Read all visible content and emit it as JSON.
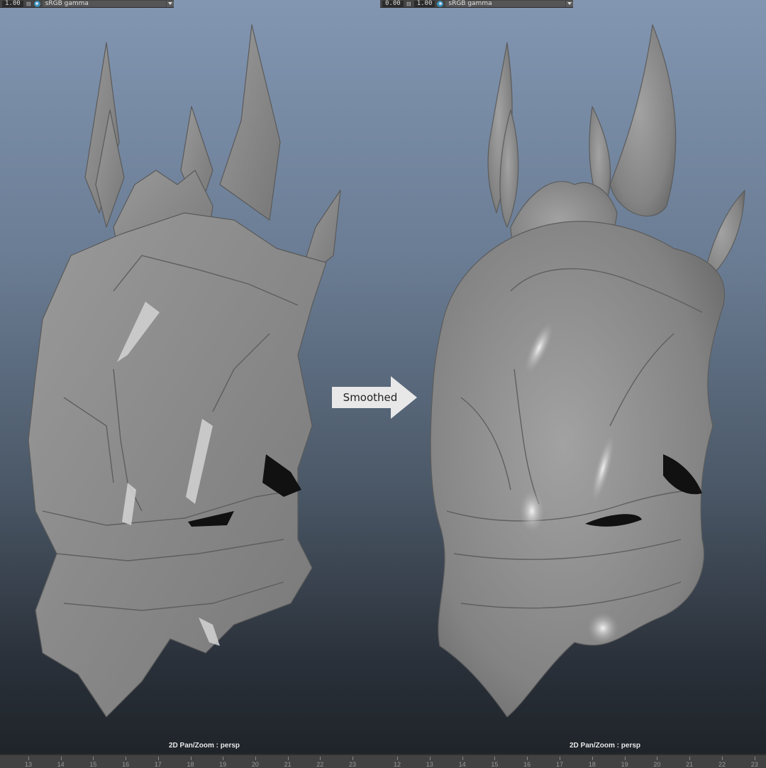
{
  "left_panel": {
    "field_value": "1.00",
    "color_space": "sRGB gamma",
    "camera_label": "2D Pan/Zoom : persp"
  },
  "right_panel": {
    "field_value_a": "0.00",
    "field_value_b": "1.00",
    "color_space": "sRGB gamma",
    "camera_label": "2D Pan/Zoom : persp"
  },
  "annotation": {
    "label": "Smoothed"
  },
  "timeline": {
    "left_ticks": [
      "13",
      "14",
      "15",
      "16",
      "17",
      "18",
      "19",
      "20",
      "21",
      "22",
      "23"
    ],
    "right_ticks": [
      "12",
      "13",
      "14",
      "15",
      "16",
      "17",
      "18",
      "19",
      "20",
      "21",
      "22",
      "23"
    ]
  },
  "colors": {
    "arrow_fill": "#e8e8e8",
    "mesh": "#8a8a8a"
  },
  "icons": [
    "exposure-icon",
    "color-management-eye-icon",
    "dropdown-chevron-icon",
    "right-arrow-icon"
  ]
}
